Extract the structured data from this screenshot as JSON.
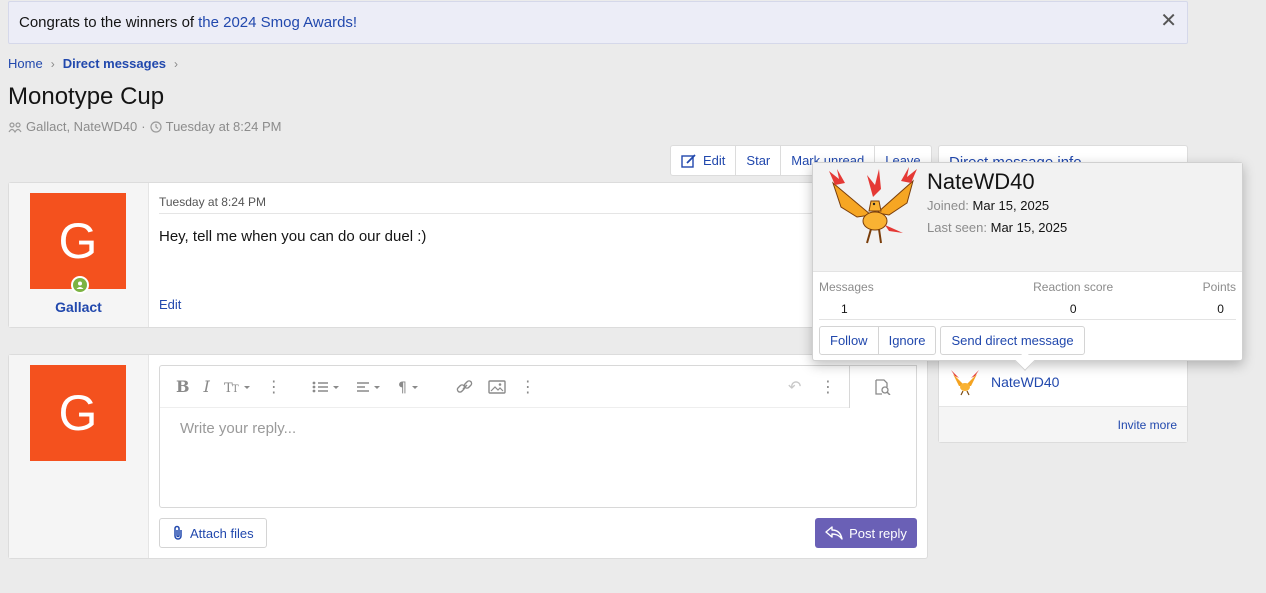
{
  "notice": {
    "text": "Congrats to the winners of",
    "link": "the 2024 Smog Awards!",
    "close": "✕"
  },
  "breadcrumb": [
    {
      "label": "Home"
    },
    {
      "label": "Direct messages"
    }
  ],
  "conversation": {
    "title": "Monotype Cup",
    "participants": "Gallact, NateWD40",
    "separator": "·",
    "time": "Tuesday at 8:24 PM"
  },
  "actions": {
    "edit": "Edit",
    "star": "Star",
    "mark_unread": "Mark unread",
    "leave": "Leave"
  },
  "sidebar": {
    "title": "Direct message info",
    "participant": "NateWD40",
    "invite": "Invite more"
  },
  "message": {
    "avatar_letter": "G",
    "author": "Gallact",
    "date": "Tuesday at 8:24 PM",
    "body": "Hey, tell me when you can do our duel :)",
    "edit": "Edit"
  },
  "reply": {
    "avatar_letter": "G",
    "placeholder": "Write your reply...",
    "attach": "Attach files",
    "post": "Post reply"
  },
  "popup": {
    "name": "NateWD40",
    "joined_label": "Joined:",
    "joined": "Mar 15, 2025",
    "seen_label": "Last seen:",
    "seen": "Mar 15, 2025",
    "stats": [
      {
        "label": "Messages",
        "value": "1"
      },
      {
        "label": "Reaction score",
        "value": "0"
      },
      {
        "label": "Points",
        "value": "0"
      }
    ],
    "follow": "Follow",
    "ignore": "Ignore",
    "send_dm": "Send direct message"
  },
  "colors": {
    "accent": "#2148ad",
    "avatar": "#f4511e",
    "post_button": "#6a60b6",
    "online": "#7cb342"
  }
}
